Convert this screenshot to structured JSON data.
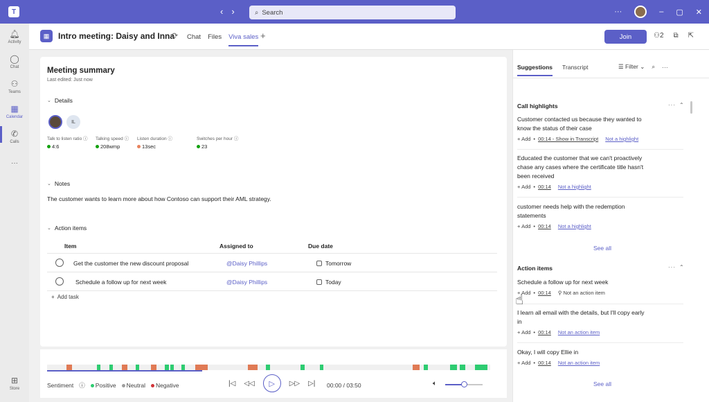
{
  "titlebar": {
    "logo": "T",
    "search_placeholder": "Search",
    "more": "···"
  },
  "rail": [
    {
      "label": "Activity",
      "icon": "bell-icon"
    },
    {
      "label": "Chat",
      "icon": "chat-icon"
    },
    {
      "label": "Teams",
      "icon": "teams-icon"
    },
    {
      "label": "Calendar",
      "icon": "calendar-icon",
      "active": true
    },
    {
      "label": "Calls",
      "icon": "phone-icon"
    },
    {
      "label": "···",
      "icon": "more-icon"
    },
    {
      "label": "Store",
      "icon": "store-icon"
    }
  ],
  "header": {
    "title": "Intro meeting: Daisy and Inna",
    "tabs": [
      "Chat",
      "Files",
      "Viva sales"
    ],
    "active_tab": "Viva sales",
    "join": "Join",
    "participants": "2"
  },
  "summary": {
    "title": "Meeting summary",
    "last_edited": "Last edited: Just now",
    "details_label": "Details",
    "avatar_initials": "IL",
    "metrics": [
      {
        "label": "Talk to listen ratio",
        "value": "4:6",
        "color": "#13a10e"
      },
      {
        "label": "Talking speed",
        "value": "208wmp",
        "color": "#13a10e"
      },
      {
        "label": "Listen duration",
        "value": "13sec",
        "color": "#e8825c"
      },
      {
        "label": "Switches per hour",
        "value": "23",
        "color": "#13a10e"
      }
    ],
    "notes_label": "Notes",
    "notes_text": "The customer wants to learn more about how Contoso  can support their AML strategy.",
    "action_label": "Action items",
    "columns": [
      "Item",
      "Assigned to",
      "Due date"
    ],
    "rows": [
      {
        "item": "Get the customer the new discount proposal",
        "assigned": "@Daisy Phillips",
        "due": "Tomorrow"
      },
      {
        "item": "Schedule a follow up for next week",
        "assigned": "@Daisy Phillips",
        "due": "Today"
      }
    ],
    "add_task": "Add task"
  },
  "player": {
    "legend_label": "Sentiment",
    "positive": "Positive",
    "neutral": "Neutral",
    "negative": "Negative",
    "time": "00:00 / 03:50",
    "progress": 0.35,
    "volume": 0.5,
    "colors": {
      "positive": "#2ecc71",
      "negative": "#e07a55",
      "neutral": "#e8e8e8"
    }
  },
  "pane": {
    "tabs": [
      "Suggestions",
      "Transcript"
    ],
    "filter": "Filter",
    "highlights_title": "Call highlights",
    "highlights": [
      {
        "text": "Customer contacted us because they wanted to know the status of their case",
        "time": "00:14 - Show in Transcript",
        "link": "Not a highlight"
      },
      {
        "text": "Educated the customer that we can't proactively chase any cases where the certificate title hasn't been received",
        "time": "00:14",
        "link": "Not a highlight"
      },
      {
        "text": "customer needs help with the redemption statements",
        "time": "00:14",
        "link": "Not a highlight"
      }
    ],
    "see_all": "See all",
    "actions_title": "Action items",
    "actions": [
      {
        "text": "Schedule a follow up for next week",
        "time": "00:14",
        "link": "Not an action item"
      },
      {
        "text": "I learn all email with the details, but I'll copy early in",
        "time": "00:14",
        "link": "Not an action item"
      },
      {
        "text": "Okay, I will copy Ellie in",
        "time": "00:14",
        "link": "Not an action item"
      }
    ],
    "add": "Add"
  }
}
